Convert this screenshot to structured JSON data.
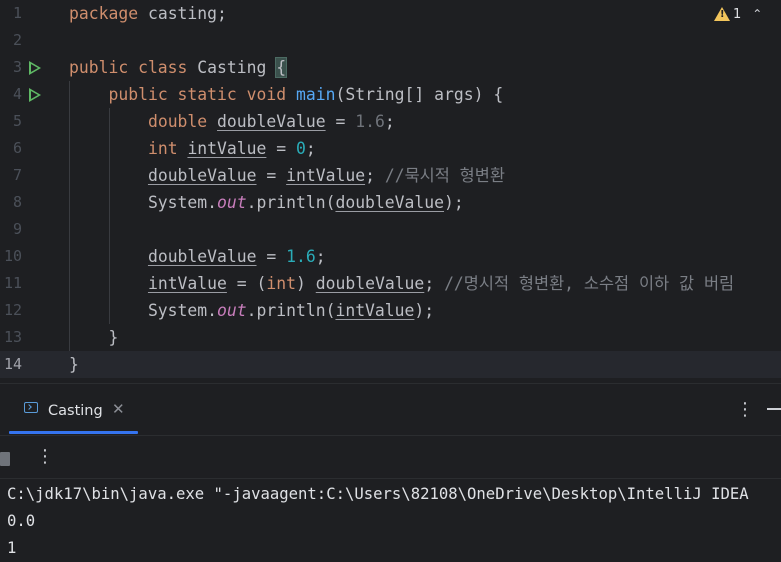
{
  "editor": {
    "line_numbers": [
      "1",
      "2",
      "3",
      "4",
      "5",
      "6",
      "7",
      "8",
      "9",
      "10",
      "11",
      "12",
      "13",
      "14"
    ],
    "current_line": 14,
    "warning_count": "1",
    "lines": [
      [
        {
          "t": "package ",
          "c": "kw"
        },
        {
          "t": "casting;"
        }
      ],
      [],
      [
        {
          "t": "public class ",
          "c": "kw"
        },
        {
          "t": "Casting "
        },
        {
          "t": "{",
          "c": "brace-hl"
        }
      ],
      [
        {
          "t": "    "
        },
        {
          "t": "public static void ",
          "c": "kw"
        },
        {
          "t": "main",
          "c": "fn"
        },
        {
          "t": "(String[] args) {"
        }
      ],
      [
        {
          "t": "        "
        },
        {
          "t": "double ",
          "c": "kw"
        },
        {
          "t": "doubleValue",
          "c": "u"
        },
        {
          "t": " = "
        },
        {
          "t": "1.6",
          "c": "num-dim"
        },
        {
          "t": ";"
        }
      ],
      [
        {
          "t": "        "
        },
        {
          "t": "int ",
          "c": "kw"
        },
        {
          "t": "intValue",
          "c": "u"
        },
        {
          "t": " = "
        },
        {
          "t": "0",
          "c": "num"
        },
        {
          "t": ";"
        }
      ],
      [
        {
          "t": "        "
        },
        {
          "t": "doubleValue",
          "c": "u"
        },
        {
          "t": " = "
        },
        {
          "t": "intValue",
          "c": "u"
        },
        {
          "t": "; "
        },
        {
          "t": "//묵시적 형변환",
          "c": "cm"
        }
      ],
      [
        {
          "t": "        System."
        },
        {
          "t": "out",
          "c": "st"
        },
        {
          "t": ".println("
        },
        {
          "t": "doubleValue",
          "c": "u"
        },
        {
          "t": ");"
        }
      ],
      [],
      [
        {
          "t": "        "
        },
        {
          "t": "doubleValue",
          "c": "u"
        },
        {
          "t": " = "
        },
        {
          "t": "1.6",
          "c": "num"
        },
        {
          "t": ";"
        }
      ],
      [
        {
          "t": "        "
        },
        {
          "t": "intValue",
          "c": "u"
        },
        {
          "t": " = ("
        },
        {
          "t": "int",
          "c": "kw"
        },
        {
          "t": ") "
        },
        {
          "t": "doubleValue",
          "c": "u"
        },
        {
          "t": "; "
        },
        {
          "t": "//명시적 형변환, 소수점 이하 값 버림",
          "c": "cm"
        }
      ],
      [
        {
          "t": "        System."
        },
        {
          "t": "out",
          "c": "st"
        },
        {
          "t": ".println("
        },
        {
          "t": "intValue",
          "c": "u"
        },
        {
          "t": ");"
        }
      ],
      [
        {
          "t": "    }"
        }
      ],
      [
        {
          "t": "}"
        }
      ]
    ]
  },
  "tool_window": {
    "tab_label": "Casting",
    "console_lines": [
      "C:\\jdk17\\bin\\java.exe \"-javaagent:C:\\Users\\82108\\OneDrive\\Desktop\\IntelliJ IDEA",
      "0.0",
      "1"
    ]
  }
}
